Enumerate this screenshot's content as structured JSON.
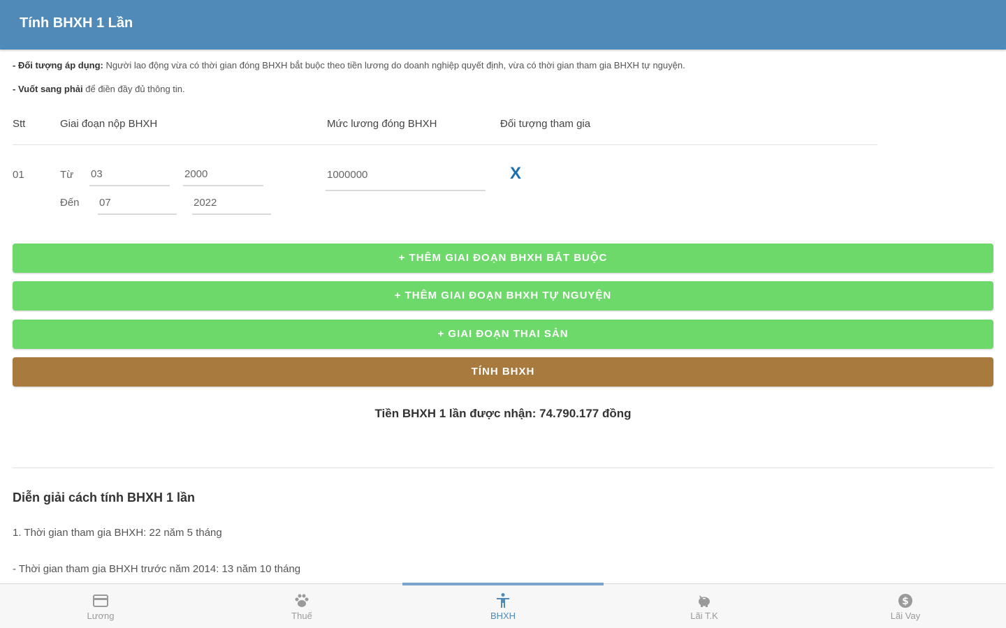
{
  "appbar": {
    "title": "Tính BHXH 1 Lần"
  },
  "notes": {
    "line1_bold": "- Đối tượng áp dụng:",
    "line1_text": " Người lao động vừa có thời gian đóng BHXH bắt buộc theo tiền lương do doanh nghiệp quyết định, vừa có thời gian tham gia BHXH tự nguyện.",
    "line2_bold": "- Vuốt sang phải",
    "line2_text": " để điền đầy đủ thông tin."
  },
  "table": {
    "headers": {
      "stt": "Stt",
      "period": "Giai đoạn nộp BHXH",
      "salary": "Mức lương đóng BHXH",
      "participant": "Đối tượng tham gia"
    },
    "row": {
      "stt": "01",
      "from_label": "Từ",
      "from_month": "03",
      "from_year": "2000",
      "to_label": "Đến",
      "to_month": "07",
      "to_year": "2022",
      "salary": "1000000",
      "delete_label": "X"
    }
  },
  "buttons": {
    "add_mandatory": "+ THÊM GIAI ĐOẠN BHXH BẮT BUỘC",
    "add_voluntary": "+ THÊM GIAI ĐOẠN BHXH TỰ NGUYỆN",
    "add_maternity": "+ GIAI ĐOẠN THAI SẢN",
    "calculate": "TÍNH BHXH"
  },
  "result": {
    "text": "Tiền BHXH 1 lần được nhận: 74.790.177 đồng"
  },
  "explanation": {
    "title": "Diễn giải cách tính BHXH 1 lần",
    "line1": "1. Thời gian tham gia BHXH: 22 năm 5 tháng",
    "line2": "- Thời gian tham gia BHXH trước năm 2014: 13 năm 10 tháng"
  },
  "tabs": [
    {
      "label": "Lương",
      "icon": "card-icon"
    },
    {
      "label": "Thuế",
      "icon": "paw-icon"
    },
    {
      "label": "BHXH",
      "icon": "person-icon",
      "active": true
    },
    {
      "label": "Lãi T.K",
      "icon": "piggy-bank-icon"
    },
    {
      "label": "Lãi Vay",
      "icon": "dollar-coin-icon"
    }
  ],
  "colors": {
    "appbar": "#4f8ab9",
    "green_button": "#6dd96a",
    "brown_button": "#a97a3e",
    "delete": "#1a6fb3",
    "active_tab": "#4f8ab9"
  }
}
